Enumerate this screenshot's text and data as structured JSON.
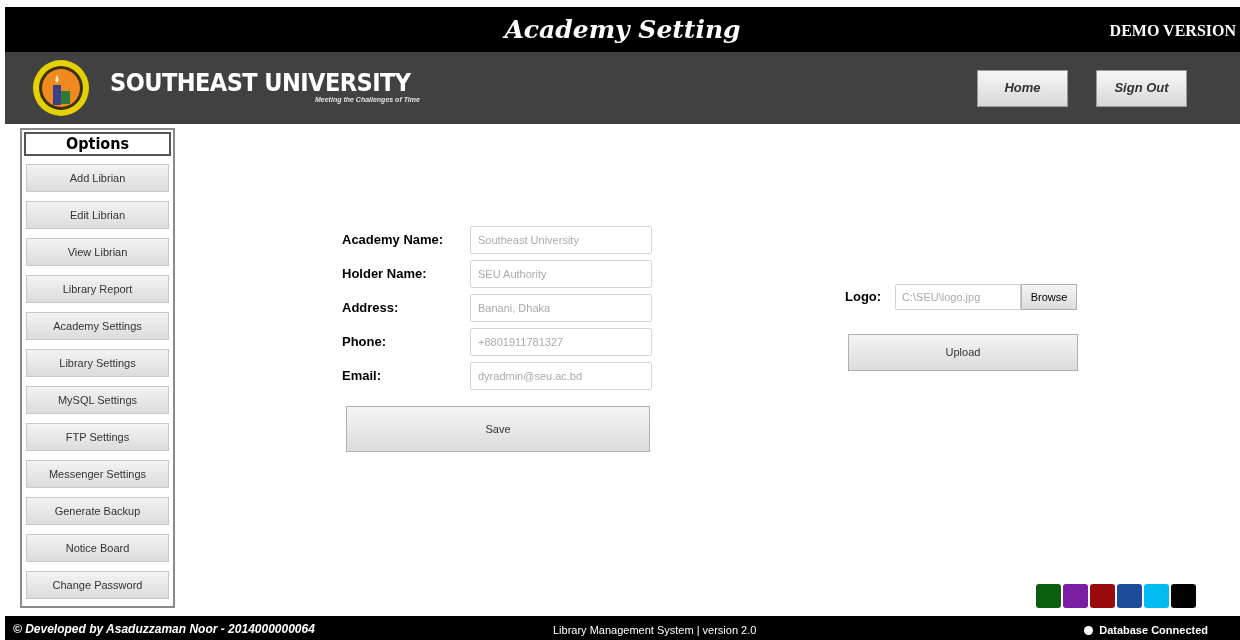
{
  "title_bar": {
    "title": "Academy Setting",
    "badge": "DEMO VERSION"
  },
  "header": {
    "brand": "SOUTHEAST UNIVERSITY",
    "tagline": "Meeting the Challenges of Time",
    "buttons": [
      "Home",
      "Sign Out"
    ]
  },
  "sidebar": {
    "heading": "Options",
    "items": [
      {
        "label": "Add Librian",
        "selected": false
      },
      {
        "label": "Edit Librian",
        "selected": false
      },
      {
        "label": "View Librian",
        "selected": false
      },
      {
        "label": "Library Report",
        "selected": false
      },
      {
        "label": "Academy Settings",
        "selected": false
      },
      {
        "label": "Library Settings",
        "selected": false
      },
      {
        "label": "MySQL Settings",
        "selected": false
      },
      {
        "label": "FTP Settings",
        "selected": false
      },
      {
        "label": "Messenger Settings",
        "selected": false
      },
      {
        "label": "Generate Backup",
        "selected": false
      },
      {
        "label": "Notice Board",
        "selected": false
      },
      {
        "label": "Change Password",
        "selected": false
      }
    ]
  },
  "form": {
    "fields": [
      {
        "label": "Academy Name:",
        "placeholder": "Southeast University"
      },
      {
        "label": "Holder Name:",
        "placeholder": "SEU Authority"
      },
      {
        "label": "Address:",
        "placeholder": "Banani, Dhaka"
      },
      {
        "label": "Phone:",
        "placeholder": "+8801911781327"
      },
      {
        "label": "Email:",
        "placeholder": "dyradmin@seu.ac.bd"
      }
    ],
    "save_button": "Save"
  },
  "logo_upload": {
    "label": "Logo:",
    "placeholder": "C:\\SEU\\logo.jpg",
    "browse_button": "Browse",
    "upload_button": "Upload"
  },
  "theme_swatches": [
    {
      "color": "#0b5e0b"
    },
    {
      "color": "#7a1fa3"
    },
    {
      "color": "#9a0a0a"
    },
    {
      "color": "#1c4b9a"
    },
    {
      "color": "#00bcf2"
    },
    {
      "color": "#000000"
    }
  ],
  "status_bar": {
    "credit": "© Developed by Asaduzzaman Noor - 2014000000064",
    "app": "Library Management System | version 2.0",
    "connection": {
      "text": "Database Connected",
      "connected": true
    }
  }
}
